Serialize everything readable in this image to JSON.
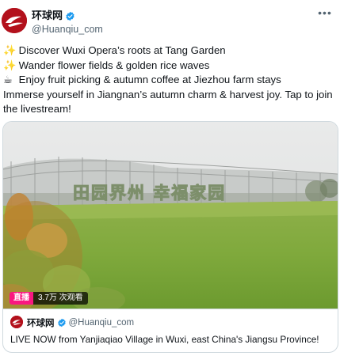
{
  "author": {
    "display_name": "环球网",
    "handle": "@Huanqiu_com",
    "verified_color": "#1d9bf0",
    "avatar_color": "#b3111c"
  },
  "more_icon": "more-horizontal-icon",
  "post": {
    "lines": [
      {
        "emoji": "✨",
        "text": "Discover Wuxi Opera’s roots at Tang Garden"
      },
      {
        "emoji": "✨",
        "text": "Wander flower fields & golden rice waves"
      },
      {
        "emoji": "☕",
        "text": "Enjoy fruit picking & autumn coffee at Jiezhou farm stays"
      }
    ],
    "closing": "Immerse yourself in Jiangnan’s autumn charm & harvest joy. Tap to join the livestream!"
  },
  "card": {
    "sign_text": "田园界州 幸福家园",
    "live_badge": "直播",
    "views": "3.7万 次观看",
    "live_color": "#f91880",
    "footer": {
      "display_name": "环球网",
      "handle": "@Huanqiu_com",
      "text": "LIVE NOW from Yanjiaqiao Village in Wuxi, east China's Jiangsu Province!"
    }
  }
}
